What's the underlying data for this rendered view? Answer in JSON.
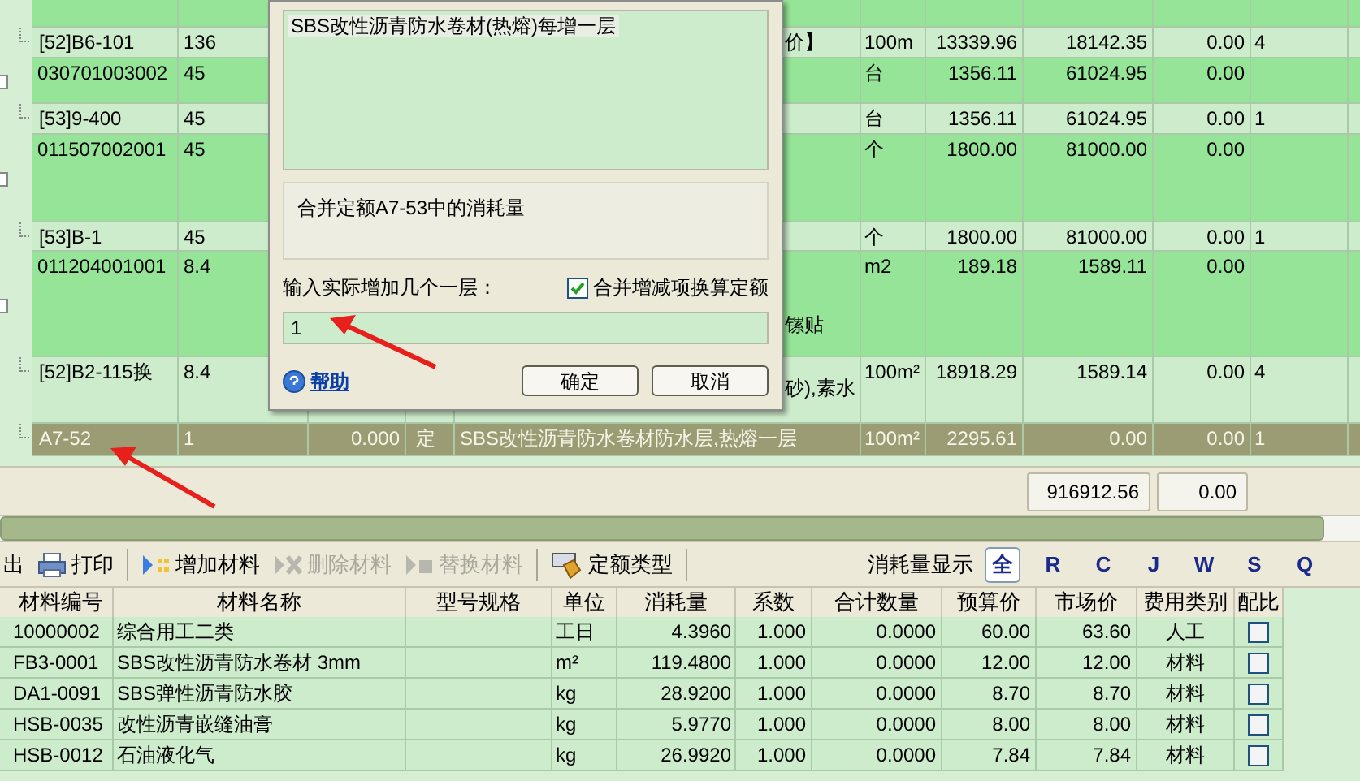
{
  "quota_grid": {
    "rows": [
      {
        "kind": "item",
        "selected": false
      },
      {
        "kind": "sub",
        "selected": false,
        "code": "[52]B6-101",
        "quantity": "136",
        "name": "价】",
        "unit": "100m",
        "column_7": "13339.96",
        "column_8": "18142.35",
        "column_9": "0.00",
        "column_10": "4"
      },
      {
        "kind": "item",
        "selected": false,
        "code": "030701003002",
        "quantity": "45",
        "unit": "台",
        "column_7": "1356.11",
        "column_8": "61024.95",
        "column_9": "0.00"
      },
      {
        "kind": "sub",
        "selected": false,
        "code": "[53]9-400",
        "quantity": "45",
        "unit": "台",
        "column_7": "1356.11",
        "column_8": "61024.95",
        "column_9": "0.00",
        "column_10": "1"
      },
      {
        "kind": "item",
        "selected": false,
        "code": "011507002001",
        "quantity": "45",
        "unit": "个",
        "column_7": "1800.00",
        "column_8": "81000.00",
        "column_9": "0.00"
      },
      {
        "kind": "sub",
        "selected": false,
        "code": "[53]B-1",
        "quantity": "45",
        "unit": "个",
        "column_7": "1800.00",
        "column_8": "81000.00",
        "column_9": "0.00",
        "column_10": "1"
      },
      {
        "kind": "item",
        "selected": false,
        "code": "011204001001",
        "quantity": "8.4",
        "name": "镙贴",
        "unit": "m2",
        "column_7": "189.18",
        "column_8": "1589.11",
        "column_9": "0.00"
      },
      {
        "kind": "sub",
        "selected": false,
        "code": "[52]B2-115换",
        "quantity": "8.4",
        "name": "砂),素水",
        "unit": "100m²",
        "column_7": "18918.29",
        "column_8": "1589.14",
        "column_9": "0.00",
        "column_10": "4"
      },
      {
        "kind": "sub",
        "selected": true,
        "code": "A7-52",
        "quantity": "1",
        "column_3": "0.000",
        "column_4": "定",
        "name": "SBS改性沥青防水卷材防水层,热熔一层",
        "unit": "100m²",
        "column_7": "2295.61",
        "column_8": "0.00",
        "column_9": "0.00",
        "column_10": "1"
      }
    ]
  },
  "dialog": {
    "list_items": [
      {
        "label": "SBS改性沥青防水卷材(热熔)每增一层",
        "selected": true
      }
    ],
    "info": "合并定额A7-53中的消耗量",
    "prompt": "输入实际增加几个一层：",
    "merge_checkbox": {
      "label": "合并增减项换算定额",
      "checked": true
    },
    "input_value": "1",
    "help_link": "帮助",
    "buttons": [
      "确定",
      "取消"
    ]
  },
  "summary": [
    "916912.56",
    "0.00"
  ],
  "toolbar": [
    {
      "label": "出",
      "disabled": false
    },
    {
      "label": "打印",
      "disabled": false
    },
    {
      "label": "增加材料",
      "disabled": false
    },
    {
      "label": "删除材料",
      "disabled": true
    },
    {
      "label": "替换材料",
      "disabled": true
    },
    {
      "label": "定额类型",
      "disabled": false
    }
  ],
  "filter": {
    "label": "消耗量显示",
    "options": [
      {
        "label": "全",
        "selected": true
      },
      {
        "label": "R",
        "selected": false
      },
      {
        "label": "C",
        "selected": false
      },
      {
        "label": "J",
        "selected": false
      },
      {
        "label": "W",
        "selected": false
      },
      {
        "label": "S",
        "selected": false
      },
      {
        "label": "Q",
        "selected": false
      }
    ]
  },
  "materials": {
    "columns": [
      "材料编号",
      "材料名称",
      "型号规格",
      "单位",
      "消耗量",
      "系数",
      "合计数量",
      "预算价",
      "市场价",
      "费用类别",
      "配比"
    ],
    "rows": [
      {
        "code": "10000002",
        "name": "综合用工二类",
        "unit": "工日",
        "consumption": "4.3960",
        "factor": "1.000",
        "total": "0.0000",
        "budget_price": "60.00",
        "market_price": "63.60",
        "category": "人工",
        "ratio_checked": false
      },
      {
        "code": "FB3-0001",
        "name": "SBS改性沥青防水卷材 3mm",
        "unit": "m²",
        "consumption": "119.4800",
        "factor": "1.000",
        "total": "0.0000",
        "budget_price": "12.00",
        "market_price": "12.00",
        "category": "材料",
        "ratio_checked": false
      },
      {
        "code": "DA1-0091",
        "name": "SBS弹性沥青防水胶",
        "unit": "kg",
        "consumption": "28.9200",
        "factor": "1.000",
        "total": "0.0000",
        "budget_price": "8.70",
        "market_price": "8.70",
        "category": "材料",
        "ratio_checked": false
      },
      {
        "code": "HSB-0035",
        "name": "改性沥青嵌缝油膏",
        "unit": "kg",
        "consumption": "5.9770",
        "factor": "1.000",
        "total": "0.0000",
        "budget_price": "8.00",
        "market_price": "8.00",
        "category": "材料",
        "ratio_checked": false
      },
      {
        "code": "HSB-0012",
        "name": "石油液化气",
        "unit": "kg",
        "consumption": "26.9920",
        "factor": "1.000",
        "total": "0.0000",
        "budget_price": "7.84",
        "market_price": "7.84",
        "category": "材料",
        "ratio_checked": false
      }
    ]
  }
}
